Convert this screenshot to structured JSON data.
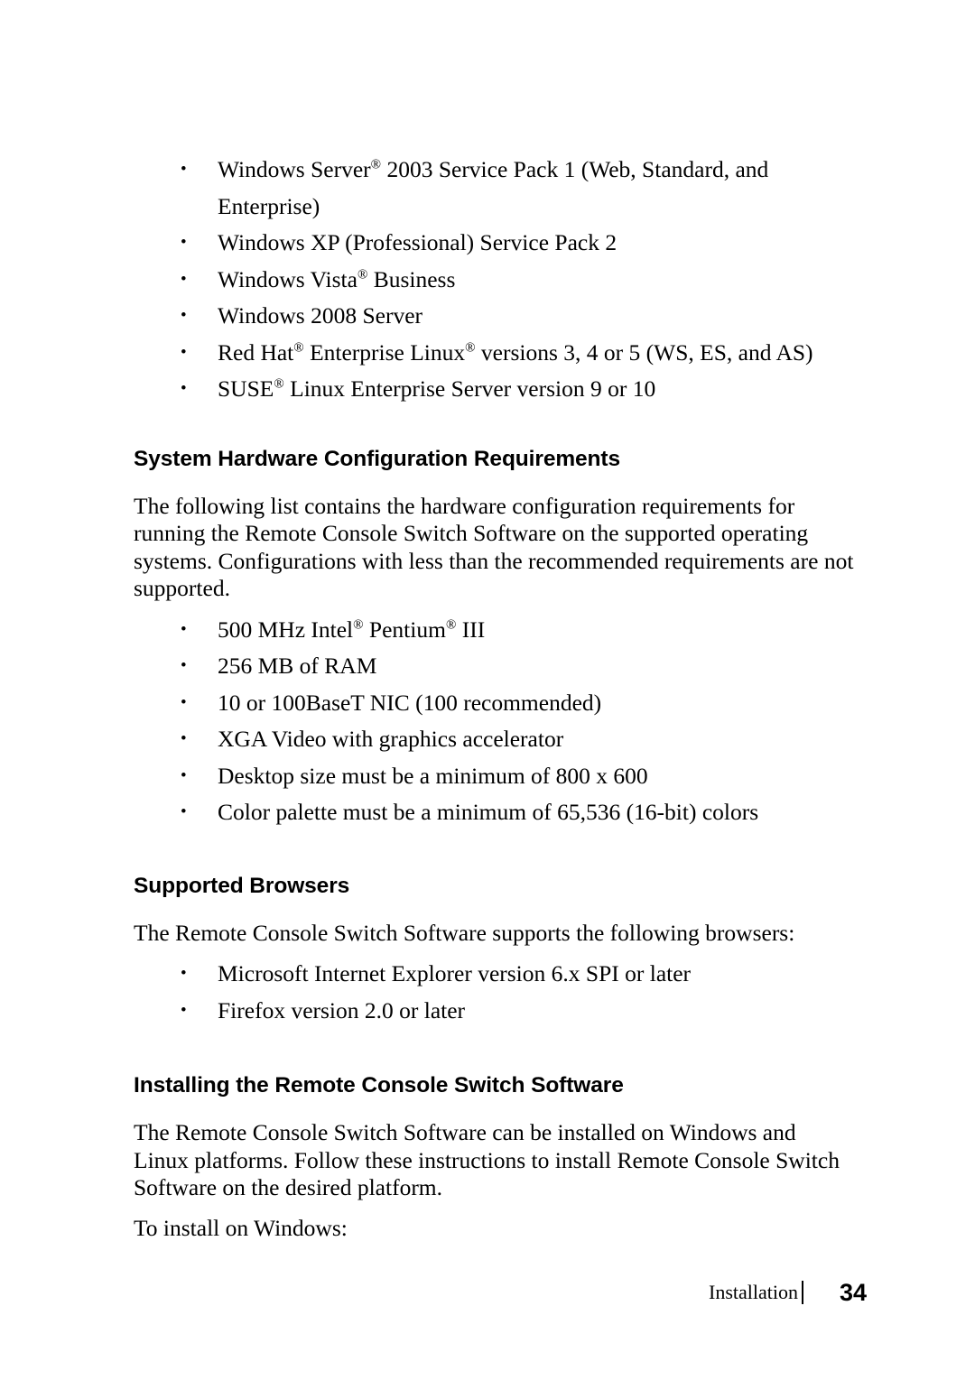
{
  "document": {
    "os_list": [
      "Windows Server® 2003 Service Pack 1 (Web, Standard, and Enterprise)",
      "Windows XP (Professional) Service Pack 2",
      "Windows Vista® Business",
      "Windows 2008 Server",
      "Red Hat® Enterprise Linux® versions 3, 4 or 5 (WS, ES, and AS)",
      "SUSE® Linux Enterprise Server version 9 or 10"
    ],
    "sections": [
      {
        "heading": "System Hardware Configuration Requirements",
        "paragraph": "The following list contains the hardware configuration requirements for running the Remote Console Switch Software on the supported operating systems. Configurations with less than the recommended requirements are not supported.",
        "items": [
          "500 MHz Intel® Pentium® III",
          "256 MB of RAM",
          "10 or 100BaseT NIC (100 recommended)",
          "XGA Video with graphics accelerator",
          "Desktop size must be a minimum of 800 x 600",
          "Color palette must be a minimum of 65,536 (16-bit) colors"
        ]
      },
      {
        "heading": "Supported Browsers",
        "paragraph": "The Remote Console Switch Software supports the following browsers:",
        "items": [
          "Microsoft Internet Explorer version 6.x SPI or later",
          "Firefox version 2.0 or later"
        ]
      },
      {
        "heading": "Installing the Remote Console Switch Software",
        "paragraph": "The Remote Console Switch Software can be installed on Windows and Linux platforms. Follow these instructions to install Remote Console Switch Software on the desired platform.",
        "paragraph2": "To install on Windows:",
        "items": []
      }
    ],
    "footer": {
      "label": "Installation",
      "page_number": "34"
    }
  }
}
